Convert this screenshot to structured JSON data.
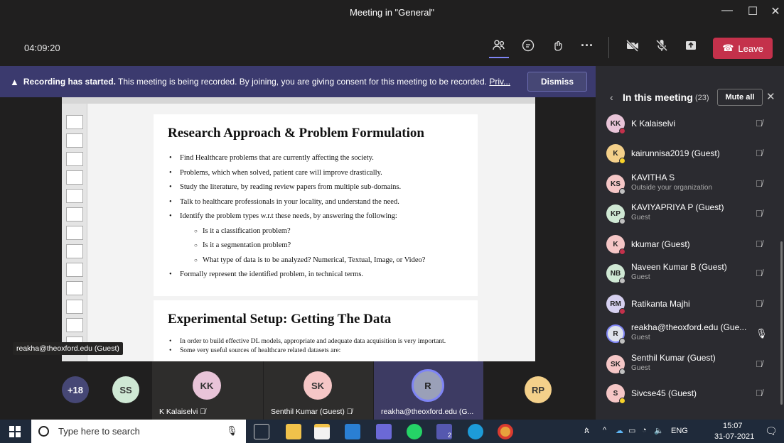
{
  "window": {
    "title": "Meeting in \"General\"",
    "minimize": "—",
    "maximize": "☐",
    "close": "✕"
  },
  "toolbar": {
    "timer": "04:09:20",
    "leave_label": "Leave",
    "more": "···"
  },
  "banner": {
    "bold": "Recording has started.",
    "text": " This meeting is being recorded. By joining, you are giving consent for this meeting to be recorded.",
    "link": "Priv...",
    "dismiss": "Dismiss"
  },
  "slides": [
    {
      "title": "Research Approach & Problem Formulation",
      "bullets": [
        {
          "level": 1,
          "text": "Find Healthcare problems that are currently affecting the society."
        },
        {
          "level": 1,
          "text": "Problems, which when solved, patient care will improve drastically."
        },
        {
          "level": 1,
          "text": "Study the literature, by reading review papers from multiple sub-domains."
        },
        {
          "level": 1,
          "text": "Talk to healthcare professionals in your locality, and understand the need."
        },
        {
          "level": 1,
          "text": "Identify the problem types w.r.t these needs, by answering the following:"
        },
        {
          "level": 2,
          "text": "Is it a classification problem?"
        },
        {
          "level": 2,
          "text": "Is it a segmentation problem?"
        },
        {
          "level": 2,
          "text": "What type of data is to be analyzed? Numerical, Textual, Image, or Video?"
        },
        {
          "level": 1,
          "text": "Formally represent the identified problem, in technical terms."
        }
      ]
    },
    {
      "title": "Experimental Setup: Getting The Data",
      "bullets": [
        {
          "level": 1,
          "text": "In order to build effective DL models, appropriate and adequate data acquisition is very important."
        },
        {
          "level": 1,
          "text": "Some very useful sources of healthcare related datasets are:"
        }
      ]
    }
  ],
  "presenter_label": "reakha@theoxford.edu (Guest)",
  "strip": {
    "more_count": "+18",
    "ss": "SS",
    "tiles": [
      {
        "initials": "KK",
        "name": "K Kalaiselvi",
        "color": "#e8c4d8"
      },
      {
        "initials": "SK",
        "name": "Senthil Kumar (Guest)",
        "color": "#f5c6c6"
      },
      {
        "initials": "R",
        "name": "reakha@theoxford.edu (G...",
        "color": "#9aa0b8"
      }
    ],
    "rp": "RP"
  },
  "panel": {
    "title": "In this meeting",
    "count": "(23)",
    "mute_all": "Mute all",
    "participants": [
      {
        "initials": "KK",
        "name": "K Kalaiselvi",
        "sub": "",
        "color": "#e8c4d8",
        "dot": "#c4314b",
        "mic": "muted"
      },
      {
        "initials": "K",
        "name": "kairunnisa2019 (Guest)",
        "sub": "",
        "color": "#f4d08a",
        "dot": "#f8d22a",
        "mic": "muted"
      },
      {
        "initials": "KS",
        "name": "KAVITHA S",
        "sub": "Outside your organization",
        "color": "#f5c6c6",
        "dot": "#c0c0c0",
        "mic": "muted"
      },
      {
        "initials": "KP",
        "name": "KAVIYAPRIYA P (Guest)",
        "sub": "Guest",
        "color": "#cfe8d4",
        "dot": "#c0c0c0",
        "mic": "muted"
      },
      {
        "initials": "K",
        "name": "kkumar (Guest)",
        "sub": "",
        "color": "#f5c6c6",
        "dot": "#c4314b",
        "mic": "muted"
      },
      {
        "initials": "NB",
        "name": "Naveen Kumar B (Guest)",
        "sub": "Guest",
        "color": "#cfe8d4",
        "dot": "#c0c0c0",
        "mic": "muted"
      },
      {
        "initials": "RM",
        "name": "Ratikanta Majhi",
        "sub": "",
        "color": "#d6d0f0",
        "dot": "#c4314b",
        "mic": "muted"
      },
      {
        "initials": "R",
        "name": "reakha@theoxford.edu (Gue...",
        "sub": "Guest",
        "color": "#dfe3ec",
        "dot": "#c0c0c0",
        "mic": "on"
      },
      {
        "initials": "SK",
        "name": "Senthil Kumar (Guest)",
        "sub": "Guest",
        "color": "#f5c6c6",
        "dot": "#c0c0c0",
        "mic": "muted"
      },
      {
        "initials": "S",
        "name": "Sivcse45 (Guest)",
        "sub": "",
        "color": "#f5c6c6",
        "dot": "#f8d22a",
        "mic": "muted"
      }
    ]
  },
  "taskbar": {
    "search_placeholder": "Type here to search",
    "lang": "ENG",
    "time": "15:07",
    "date": "31-07-2021",
    "teams_badge": "2"
  }
}
